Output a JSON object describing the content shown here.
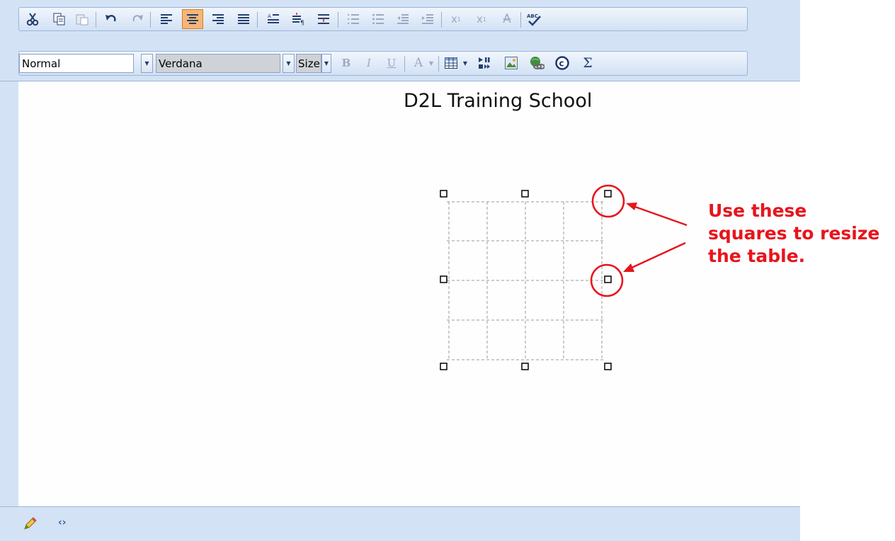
{
  "toolbar": {
    "row1": [
      {
        "name": "cut-button",
        "glyph": "✂",
        "state": "normal"
      },
      {
        "name": "copy-button",
        "glyph": "⎘",
        "state": "normal"
      },
      {
        "name": "paste-button",
        "glyph": "📋",
        "state": "disabled"
      },
      {
        "name": "undo-button",
        "glyph": "↶",
        "state": "normal"
      },
      {
        "name": "redo-button",
        "glyph": "↷",
        "state": "disabled"
      },
      {
        "name": "align-left-button",
        "glyph": "≡",
        "state": "normal"
      },
      {
        "name": "align-center-button",
        "glyph": "≡",
        "state": "active"
      },
      {
        "name": "align-right-button",
        "glyph": "≡",
        "state": "normal"
      },
      {
        "name": "justify-button",
        "glyph": "≡",
        "state": "normal"
      },
      {
        "name": "line-spacing-button",
        "glyph": "⇕",
        "state": "normal"
      },
      {
        "name": "paragraph-button",
        "glyph": "¶",
        "state": "normal"
      },
      {
        "name": "horizontal-rule-button",
        "glyph": "―",
        "state": "normal"
      },
      {
        "name": "numbered-list-button",
        "glyph": "⒈",
        "state": "disabled"
      },
      {
        "name": "bullet-list-button",
        "glyph": "•",
        "state": "disabled"
      },
      {
        "name": "outdent-button",
        "glyph": "⇤",
        "state": "disabled"
      },
      {
        "name": "indent-button",
        "glyph": "⇥",
        "state": "disabled"
      },
      {
        "name": "superscript-button",
        "glyph": "x²",
        "state": "disabled"
      },
      {
        "name": "subscript-button",
        "glyph": "x₂",
        "state": "disabled"
      },
      {
        "name": "strikethrough-button",
        "glyph": "A",
        "state": "disabled"
      },
      {
        "name": "spellcheck-button",
        "glyph": "ABC✓",
        "state": "normal"
      }
    ],
    "format_select": "Normal",
    "font_select": "Verdana",
    "size_select": "Size",
    "row2_icons": [
      {
        "name": "bold-button",
        "glyph": "B",
        "state": "disabled"
      },
      {
        "name": "italic-button",
        "glyph": "I",
        "state": "disabled"
      },
      {
        "name": "underline-button",
        "glyph": "U",
        "state": "disabled"
      },
      {
        "name": "font-color-button",
        "glyph": "A",
        "state": "disabled"
      },
      {
        "name": "insert-table-button",
        "glyph": "▦",
        "state": "normal"
      },
      {
        "name": "insert-media-button",
        "glyph": "▶",
        "state": "normal"
      },
      {
        "name": "insert-image-button",
        "glyph": "🖼",
        "state": "normal"
      },
      {
        "name": "insert-link-button",
        "glyph": "🔗",
        "state": "normal"
      },
      {
        "name": "insert-symbol-button",
        "glyph": "©",
        "state": "normal"
      },
      {
        "name": "insert-equation-button",
        "glyph": "Σ",
        "state": "normal"
      }
    ]
  },
  "document": {
    "title": "D2L Training School"
  },
  "annotation": {
    "line1": "Use these",
    "line2": "squares to resize",
    "line3": "the table.",
    "color": "#e8141c"
  },
  "status_bar": {
    "design_icon": "✎",
    "html_icon": "‹›"
  }
}
